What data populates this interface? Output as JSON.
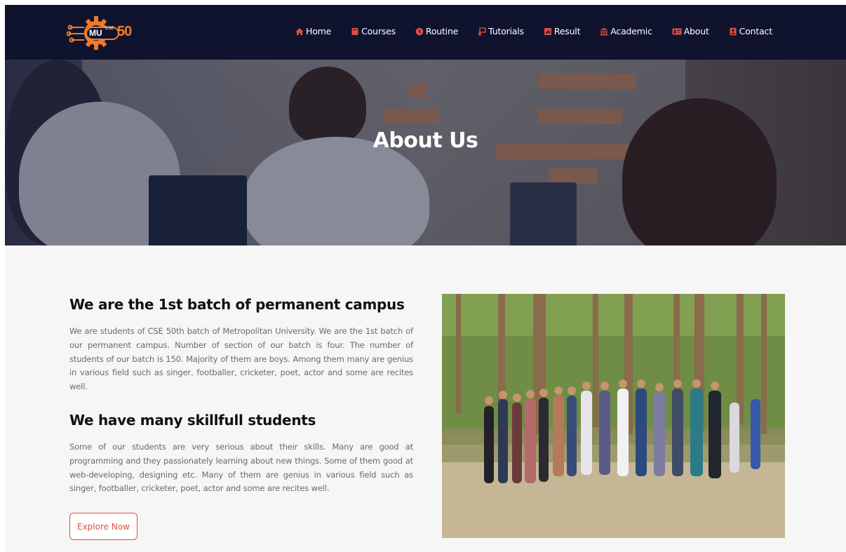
{
  "nav": {
    "logo": {
      "mu": "MU",
      "cse": "CSE",
      "number": "50"
    },
    "items": [
      {
        "label": "Home",
        "icon": "home-icon"
      },
      {
        "label": "Courses",
        "icon": "book-icon"
      },
      {
        "label": "Routine",
        "icon": "clock-icon"
      },
      {
        "label": "Tutorials",
        "icon": "tutorial-icon"
      },
      {
        "label": "Result",
        "icon": "result-icon"
      },
      {
        "label": "Academic",
        "icon": "institution-icon"
      },
      {
        "label": "About",
        "icon": "id-card-icon"
      },
      {
        "label": "Contact",
        "icon": "contact-icon"
      }
    ]
  },
  "hero": {
    "title": "About Us"
  },
  "main": {
    "section1": {
      "heading": "We are the 1st batch of permanent campus",
      "body": "We are students of CSE 50th batch of Metropolitan University. We are the 1st batch of our permanent campus. Number of section of our batch is four. The number of students of our batch is 150. Majority of them are boys. Among them many are genius in various field such as singer, footballer, cricketer, poet, actor and some are recites well."
    },
    "section2": {
      "heading": "We have many skillfull students",
      "body": "Some of our students are very serious about their skills. Many are good at programming and they passionately learning about new things. Some of them good at web-developing, designing etc. Many of them are genius in various field such as singer, footballer, cricketer, poet, actor and some are recites well."
    },
    "cta_label": "Explore Now"
  },
  "colors": {
    "nav_bg": "#10132e",
    "accent": "#e1503f",
    "logo_orange": "#f07a2a",
    "page_bg": "#f6f6f6"
  }
}
